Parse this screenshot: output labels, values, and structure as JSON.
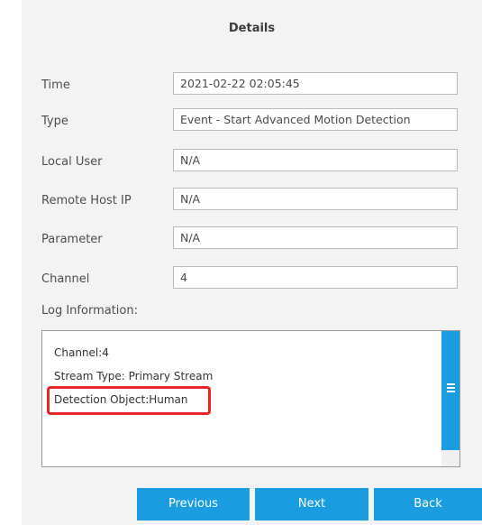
{
  "dialog": {
    "title": "Details"
  },
  "fields": {
    "time": {
      "label": "Time",
      "value": "2021-02-22 02:05:45"
    },
    "type": {
      "label": "Type",
      "value": "Event - Start Advanced Motion Detection"
    },
    "local_user": {
      "label": "Local User",
      "value": "N/A"
    },
    "remote_host_ip": {
      "label": "Remote Host IP",
      "value": "N/A"
    },
    "parameter": {
      "label": "Parameter",
      "value": "N/A"
    },
    "channel": {
      "label": "Channel",
      "value": "4"
    }
  },
  "log": {
    "label": "Log Information:",
    "lines": [
      "Channel:4",
      "Stream Type: Primary Stream",
      "Detection Object:Human"
    ]
  },
  "buttons": {
    "previous": "Previous",
    "next": "Next",
    "back": "Back"
  },
  "colors": {
    "accent": "#1a9ce1",
    "highlight": "#e8252b",
    "panel": "#f3f3f3"
  }
}
